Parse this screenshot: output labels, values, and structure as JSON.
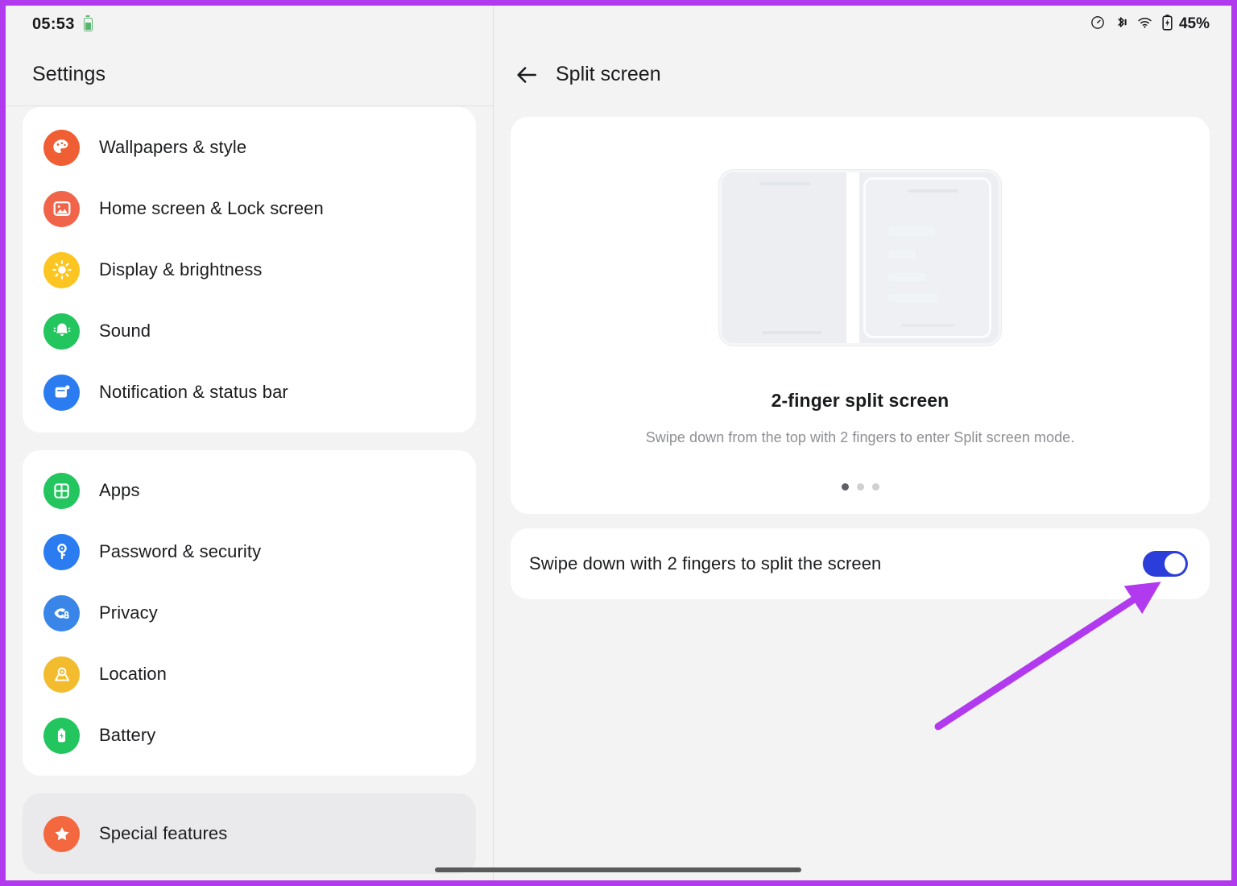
{
  "statusbar": {
    "clock": "05:53",
    "left_battery_icon": "battery-charging-icon",
    "icons": [
      "data-saver-icon",
      "bluetooth-icon",
      "wifi-icon",
      "battery-charging-icon"
    ],
    "battery_percent": "45%"
  },
  "sidebar": {
    "title": "Settings",
    "groups": [
      {
        "items": [
          {
            "label": "Wallpapers & style",
            "icon": "palette-icon",
            "color": "#ef5f33"
          },
          {
            "label": "Home screen & Lock screen",
            "icon": "image-icon",
            "color": "#f0654a"
          },
          {
            "label": "Display & brightness",
            "icon": "sun-icon",
            "color": "#fcc521"
          },
          {
            "label": "Sound",
            "icon": "bell-icon",
            "color": "#23c55e"
          },
          {
            "label": "Notification & status bar",
            "icon": "notification-icon",
            "color": "#2b7cf0"
          }
        ]
      },
      {
        "items": [
          {
            "label": "Apps",
            "icon": "grid-icon",
            "color": "#23c55e"
          },
          {
            "label": "Password & security",
            "icon": "key-icon",
            "color": "#2b7cf0"
          },
          {
            "label": "Privacy",
            "icon": "eye-lock-icon",
            "color": "#3a86e8"
          },
          {
            "label": "Location",
            "icon": "location-icon",
            "color": "#f3bc2e"
          },
          {
            "label": "Battery",
            "icon": "battery-icon",
            "color": "#23c55e"
          }
        ]
      },
      {
        "selected": true,
        "items": [
          {
            "label": "Special features",
            "icon": "star-icon",
            "color": "#f4683f"
          }
        ]
      }
    ]
  },
  "detail": {
    "back_icon": "back-arrow-icon",
    "title": "Split screen",
    "illustration": {
      "name": "split-screen-illustration",
      "headline": "2-finger split screen",
      "subtext": "Swipe down from the top with 2 fingers to enter Split screen mode.",
      "dots_total": 3,
      "dots_active_index": 0
    },
    "toggle": {
      "label": "Swipe down with 2 fingers to split the screen",
      "state": "on",
      "color": "#2c3ed9"
    }
  },
  "annotation": {
    "arrow_color": "#b23aee",
    "border_color": "#b23aee"
  }
}
